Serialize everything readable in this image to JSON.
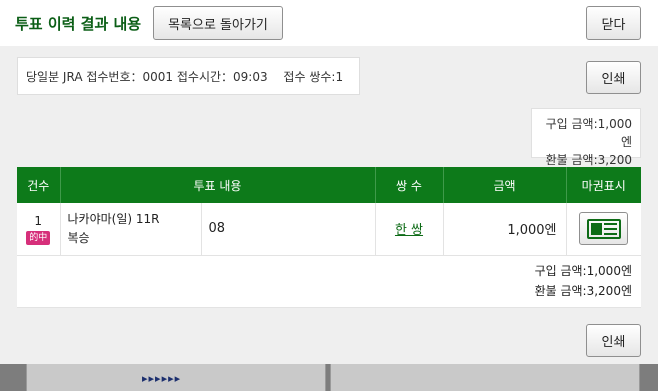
{
  "header": {
    "title": "투표 이력 결과 내용",
    "back_label": "목록으로 돌아가기",
    "close_label": "닫다"
  },
  "info": {
    "text": "당일분 JRA 접수번호：0001 접수시간：09:03　 접수 쌍수:1"
  },
  "print_label": "인쇄",
  "summary": {
    "purchase": "구입 금액:1,000엔",
    "refund": "환불 금액:3,200엔"
  },
  "table": {
    "headers": [
      "건수",
      "투표 내용",
      "쌍 수",
      "금액",
      "마권표시"
    ],
    "rows": [
      {
        "no": "1",
        "hit": "的中",
        "race": "나카야마(일) 11R",
        "bet_type": "복승",
        "selection": "08",
        "count": "한 쌍",
        "amount": "1,000엔"
      }
    ]
  },
  "colors": {
    "accent": "#0d7a1a",
    "title": "#0b5e16",
    "hit_badge": "#d62f7a"
  },
  "icons": {
    "ticket": "ticket-icon"
  }
}
